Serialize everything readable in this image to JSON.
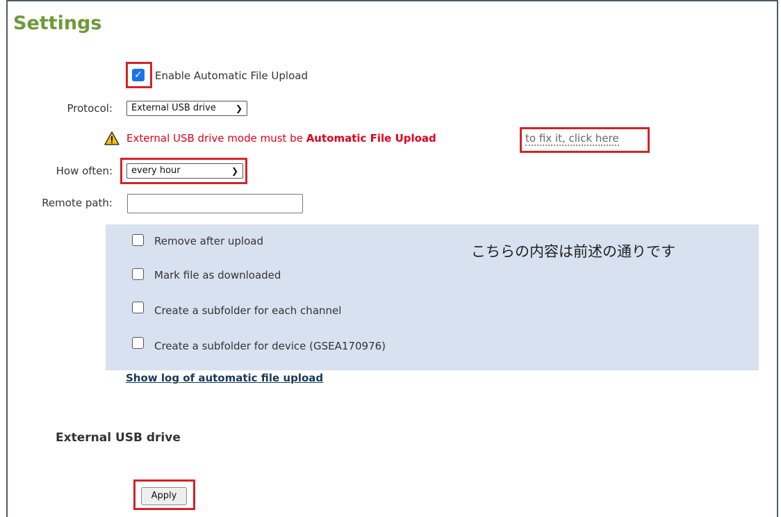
{
  "page": {
    "title": "Settings"
  },
  "upload": {
    "enable_label": "Enable Automatic File Upload",
    "enable_checked": true,
    "protocol_label": "Protocol:",
    "protocol_value": "External USB drive",
    "warning_prefix": "External USB drive mode must be ",
    "warning_bold": "Automatic File Upload",
    "fix_link": "to fix it, click here",
    "how_often_label": "How often:",
    "how_often_value": "every hour",
    "remote_path_label": "Remote path:",
    "remote_path_value": "",
    "options": [
      {
        "label": "Remove after upload",
        "checked": false
      },
      {
        "label": "Mark file as downloaded",
        "checked": false
      },
      {
        "label": "Create a subfolder for each channel",
        "checked": false
      },
      {
        "label": "Create a subfolder for device (GSEA170976)",
        "checked": false
      }
    ],
    "annotation": "こちらの内容は前述の通りです",
    "log_link": "Show log of automatic file upload"
  },
  "usb": {
    "section_title": "External USB drive",
    "apply_label": "Apply"
  },
  "colors": {
    "title_green": "#6e9a3a",
    "warning_red": "#e3001b",
    "highlight_red": "#d2232a",
    "panel_blue": "#d8e1ef",
    "checkbox_blue": "#1a73e8"
  },
  "icons": {
    "warning": "warning-triangle-icon",
    "checkbox_checked": "checkmark-icon",
    "select_chevron": "chevron-down-icon"
  }
}
